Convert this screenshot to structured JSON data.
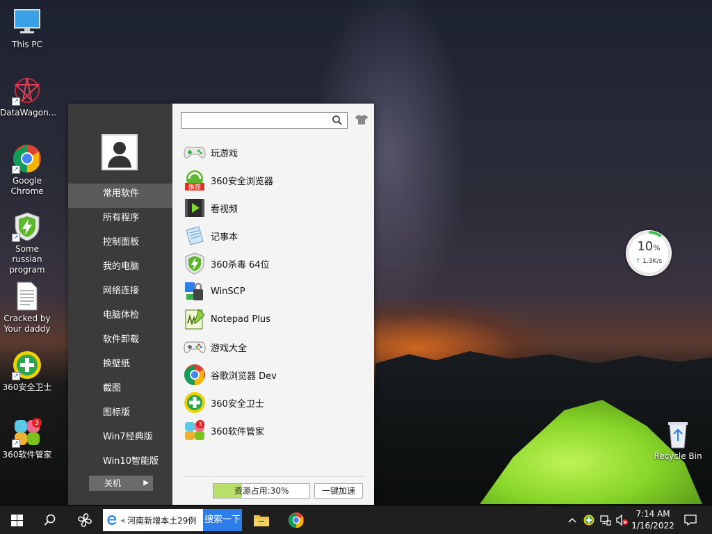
{
  "desktop": {
    "icons": [
      {
        "label": "This PC"
      },
      {
        "label": "DataWagon..."
      },
      {
        "label": "Google Chrome"
      },
      {
        "label": "Some russian program"
      },
      {
        "label": "Cracked by Your daddy"
      },
      {
        "label": "360安全卫士"
      },
      {
        "label": "360软件管家"
      },
      {
        "label": "Recycle Bin"
      }
    ]
  },
  "start_menu": {
    "nav": [
      {
        "label": "常用软件",
        "active": true
      },
      {
        "label": "所有程序"
      },
      {
        "label": "控制面板"
      },
      {
        "label": "我的电脑"
      },
      {
        "label": "网络连接"
      },
      {
        "label": "电脑体检"
      },
      {
        "label": "软件卸载"
      },
      {
        "label": "换壁纸"
      },
      {
        "label": "截图"
      },
      {
        "label": "图标版"
      },
      {
        "label": "Win7经典版"
      },
      {
        "label": "Win10智能版"
      }
    ],
    "shutdown_label": "关机",
    "search": {
      "value": "",
      "placeholder": ""
    },
    "apps": [
      {
        "label": "玩游戏"
      },
      {
        "label": "360安全浏览器",
        "badge": "推荐"
      },
      {
        "label": "看视频"
      },
      {
        "label": "记事本"
      },
      {
        "label": "360杀毒 64位"
      },
      {
        "label": "WinSCP"
      },
      {
        "label": "Notepad Plus"
      },
      {
        "label": "游戏大全"
      },
      {
        "label": "谷歌浏览器 Dev"
      },
      {
        "label": "360安全卫士"
      },
      {
        "label": "360软件管家",
        "badge": "3"
      }
    ],
    "resource": {
      "label": "资源占用:30%",
      "percent": 30
    },
    "speedup_label": "一键加速"
  },
  "net_widget": {
    "percent": "10",
    "percent_sign": "%",
    "speed": "1.3K/s",
    "ring_fraction": 0.1
  },
  "taskbar": {
    "search_text": "河南新增本土29例",
    "search_button": "搜索一下",
    "time": "7:14 AM",
    "date": "1/16/2022"
  },
  "colors": {
    "menu_left": "#3b3b3b",
    "menu_right": "#f4f4f4",
    "accent_blue": "#2b7de9",
    "green_360": "#7dc11e"
  }
}
